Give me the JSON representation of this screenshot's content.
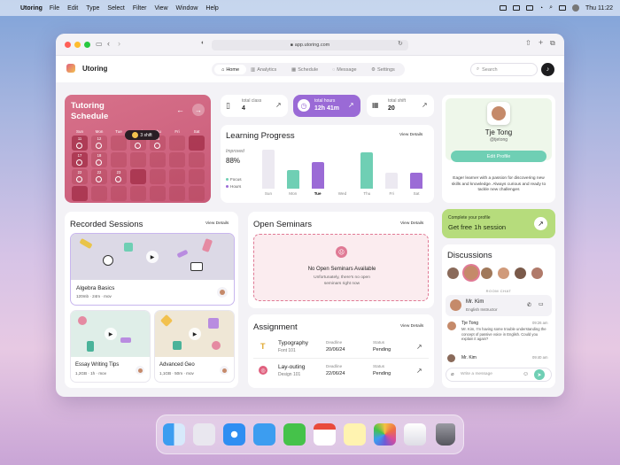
{
  "menubar": {
    "app": "Utoring",
    "items": [
      "File",
      "Edit",
      "Type",
      "Select",
      "Filter",
      "View",
      "Window",
      "Help"
    ],
    "clock": "Thu 11:22"
  },
  "browser": {
    "url": "app.utoring.com"
  },
  "brand": {
    "name": "Utoring"
  },
  "nav": {
    "tabs": [
      {
        "label": "Home",
        "icon": "home-icon"
      },
      {
        "label": "Analytics",
        "icon": "chart-icon"
      },
      {
        "label": "Schedule",
        "icon": "calendar-icon"
      },
      {
        "label": "Message",
        "icon": "message-icon"
      },
      {
        "label": "Settings",
        "icon": "gear-icon"
      }
    ],
    "search_placeholder": "Search"
  },
  "schedule": {
    "title": "Tutoring Schedule",
    "days": [
      "Sun",
      "Mon",
      "Tue",
      "Wed",
      "Thu",
      "Fri",
      "Sat"
    ],
    "tooltip": "3 shift",
    "rows": [
      [
        "11",
        "12",
        "",
        "14",
        "15",
        "",
        ""
      ],
      [
        "17",
        "18",
        "",
        "",
        "",
        "",
        ""
      ],
      [
        "24",
        "25",
        "26",
        "",
        "",
        "",
        ""
      ]
    ],
    "extra": [
      "22",
      "22",
      "23",
      "",
      "",
      ""
    ]
  },
  "stats": {
    "total_class_label": "total class",
    "total_class_value": "4",
    "total_hours_label": "total hours",
    "total_hours_value": "12h 41m",
    "total_shift_label": "total shift",
    "total_shift_value": "20"
  },
  "learning": {
    "title": "Learning Progress",
    "view": "View Details",
    "improved_label": "Improved",
    "improved_value": "88%",
    "legend": [
      "Focus",
      "Hours"
    ]
  },
  "chart_data": {
    "type": "bar",
    "categories": [
      "Sun",
      "Mon",
      "Tue",
      "Wed",
      "Thu",
      "Fri",
      "Sat"
    ],
    "series": [
      {
        "name": "Focus",
        "values": [
          0,
          45,
          0,
          0,
          90,
          0,
          0
        ]
      },
      {
        "name": "Hours",
        "values": [
          0,
          0,
          65,
          0,
          0,
          0,
          40
        ]
      },
      {
        "name": "",
        "values": [
          95,
          0,
          0,
          0,
          0,
          40,
          0
        ]
      }
    ],
    "highlight": "Tue",
    "colors": {
      "Focus": "#6fcfb4",
      "Hours": "#9b6bd6",
      "base": "#ece9f1"
    }
  },
  "profile": {
    "name": "Tje Tong",
    "handle": "@tjetong",
    "button": "Edit Profile",
    "bio": "Eager learner with a passion for discovering new skills and knowledge. Always curious and ready to tackle new challenges"
  },
  "promo": {
    "line1": "Complete your profile",
    "line2": "Get free 1h session"
  },
  "recorded": {
    "title": "Recorded Sessions",
    "view": "View Details",
    "items": [
      {
        "title": "Algebra Basics",
        "size": "120mb",
        "duration": "24m",
        "format": "mov"
      },
      {
        "title": "Essay Writing Tips",
        "size": "1,2GB",
        "duration": "1h",
        "format": "mov"
      },
      {
        "title": "Advanced Geo",
        "size": "1,1GB",
        "duration": "50m",
        "format": "mov"
      }
    ]
  },
  "seminars": {
    "title": "Open Seminars",
    "view": "View Details",
    "empty_title": "No Open Seminars Available",
    "empty_text": "Unfortunately, there's no open seminars right now"
  },
  "assignment": {
    "title": "Assignment",
    "view": "View Details",
    "items": [
      {
        "name": "Typography",
        "course": "Font 101",
        "deadline_label": "Deadline",
        "deadline": "20/06/24",
        "status_label": "Status",
        "status": "Pending"
      },
      {
        "name": "Lay-outing",
        "course": "Design 101",
        "deadline_label": "Deadline",
        "deadline": "22/06/24",
        "status_label": "Status",
        "status": "Pending"
      }
    ]
  },
  "discussions": {
    "title": "Discussions",
    "room_label": "ROOM CHAT",
    "contact_name": "Mr. Kim",
    "contact_role": "English Instructor",
    "messages": [
      {
        "name": "Tje Tong",
        "time": "09:26 am",
        "text": "Mr. Kim, I'm having some trouble understanding the concept of passive voice in English. Could you explain it again?"
      },
      {
        "name": "Mr. Kim",
        "time": "09:40 am",
        "text": ""
      }
    ],
    "input_placeholder": "Write a message"
  }
}
